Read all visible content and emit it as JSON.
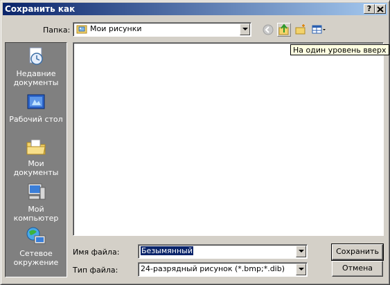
{
  "window": {
    "title": "Сохранить как",
    "help_label": "?",
    "close_label": "X"
  },
  "toolbar": {
    "folder_label": "Папка:",
    "folder_value": "Мои рисунки",
    "tooltip": "На один уровень вверх"
  },
  "places": [
    {
      "label_line1": "Недавние",
      "label_line2": "документы",
      "icon": "recent-documents-icon"
    },
    {
      "label_line1": "Рабочий стол",
      "label_line2": "",
      "icon": "desktop-icon"
    },
    {
      "label_line1": "Мои",
      "label_line2": "документы",
      "icon": "my-documents-icon"
    },
    {
      "label_line1": "Мой",
      "label_line2": "компьютер",
      "icon": "my-computer-icon"
    },
    {
      "label_line1": "Сетевое",
      "label_line2": "окружение",
      "icon": "network-icon"
    }
  ],
  "form": {
    "filename_label": "Имя файла:",
    "filename_value": "Безымянный",
    "filetype_label": "Тип файла:",
    "filetype_value": "24-разрядный рисунок (*.bmp;*.dib)"
  },
  "buttons": {
    "save": "Сохранить",
    "cancel": "Отмена"
  }
}
